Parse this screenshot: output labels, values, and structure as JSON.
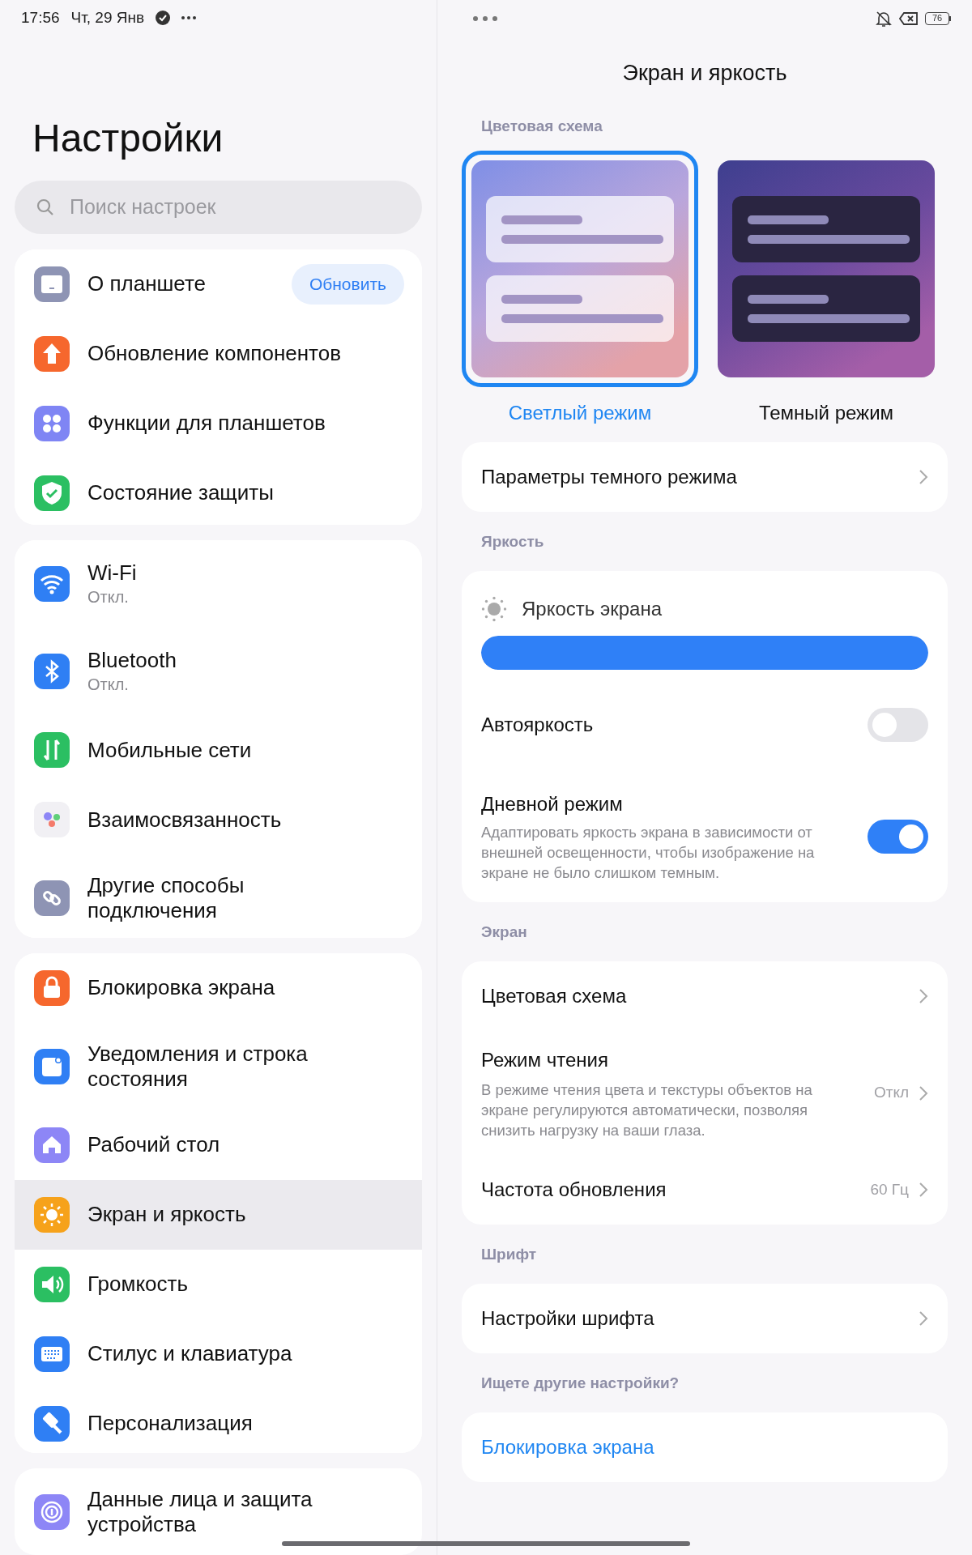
{
  "status_bar": {
    "time": "17:56",
    "date": "Чт, 29 Янв",
    "battery": "76"
  },
  "sidebar": {
    "title": "Настройки",
    "search": {
      "placeholder": "Поиск настроек"
    },
    "groups": [
      [
        {
          "label": "О планшете",
          "color": "#8e94b4",
          "selected": false,
          "button": "Обновить"
        },
        {
          "label": "Обновление компонентов",
          "color": "#f6672d",
          "selected": false
        },
        {
          "label": "Функции для планшетов",
          "color": "#7f85f4",
          "selected": false
        },
        {
          "label": "Состояние защиты",
          "color": "#2bbf62",
          "selected": false
        }
      ],
      [
        {
          "label": "Wi-Fi",
          "sublabel": "Откл.",
          "color": "#2f7ff4",
          "selected": false
        },
        {
          "label": "Bluetooth",
          "sublabel": "Откл.",
          "color": "#2f7ff4",
          "selected": false
        },
        {
          "label": "Мобильные сети",
          "color": "#2bbf62",
          "selected": false
        },
        {
          "label": "Взаимосвязанность",
          "color": "#f1f0f4",
          "selected": false
        },
        {
          "label": "Другие способы подключения",
          "color": "#8e94b4",
          "selected": false
        }
      ],
      [
        {
          "label": "Блокировка экрана",
          "color": "#f6672d",
          "selected": false
        },
        {
          "label": "Уведомления и строка состояния",
          "color": "#2f7ff4",
          "selected": false
        },
        {
          "label": "Рабочий стол",
          "color": "#8d86f6",
          "selected": false
        },
        {
          "label": "Экран и яркость",
          "color": "#f6a21b",
          "selected": true
        },
        {
          "label": "Громкость",
          "color": "#2bbf62",
          "selected": false
        },
        {
          "label": "Стилус и клавиатура",
          "color": "#2f7ff4",
          "selected": false
        },
        {
          "label": "Персонализация",
          "color": "#2f7ff4",
          "selected": false
        }
      ],
      [
        {
          "label": "Данные лица и защита устройства",
          "color": "#8d86f6",
          "selected": false
        }
      ]
    ]
  },
  "detail": {
    "title": "Экран и яркость",
    "color_scheme": {
      "header": "Цветовая схема",
      "options": [
        {
          "kind": "light",
          "label": "Светлый режим",
          "selected": true
        },
        {
          "kind": "dark",
          "label": "Темный режим",
          "selected": false
        }
      ]
    },
    "sections": [
      {
        "rows": [
          {
            "kind": "link",
            "label": "Параметры темного режима"
          }
        ]
      },
      {
        "header": "Яркость",
        "rows": [
          {
            "kind": "slider",
            "label": "Яркость экрана",
            "level": 1
          },
          {
            "kind": "toggle",
            "label": "Автояркость",
            "on": false
          },
          {
            "kind": "toggle",
            "label": "Дневной режим",
            "description": "Адаптировать яркость экрана в зависимости от внешней освещенности, чтобы изображение на экране не было слишком темным.",
            "on": true
          }
        ]
      },
      {
        "header": "Экран",
        "rows": [
          {
            "kind": "link",
            "label": "Цветовая схема"
          },
          {
            "kind": "link",
            "label": "Режим чтения",
            "description": "В режиме чтения цвета и текстуры объектов на экране регулируются автоматически, позволяя снизить нагрузку на ваши глаза.",
            "value": "Откл"
          },
          {
            "kind": "link",
            "label": "Частота обновления",
            "value": "60 Гц"
          }
        ]
      },
      {
        "header": "Шрифт",
        "rows": [
          {
            "kind": "link",
            "label": "Настройки шрифта"
          }
        ]
      },
      {
        "header": "Ищете другие настройки?",
        "rows": [
          {
            "kind": "action",
            "label": "Блокировка экрана"
          }
        ]
      }
    ]
  }
}
